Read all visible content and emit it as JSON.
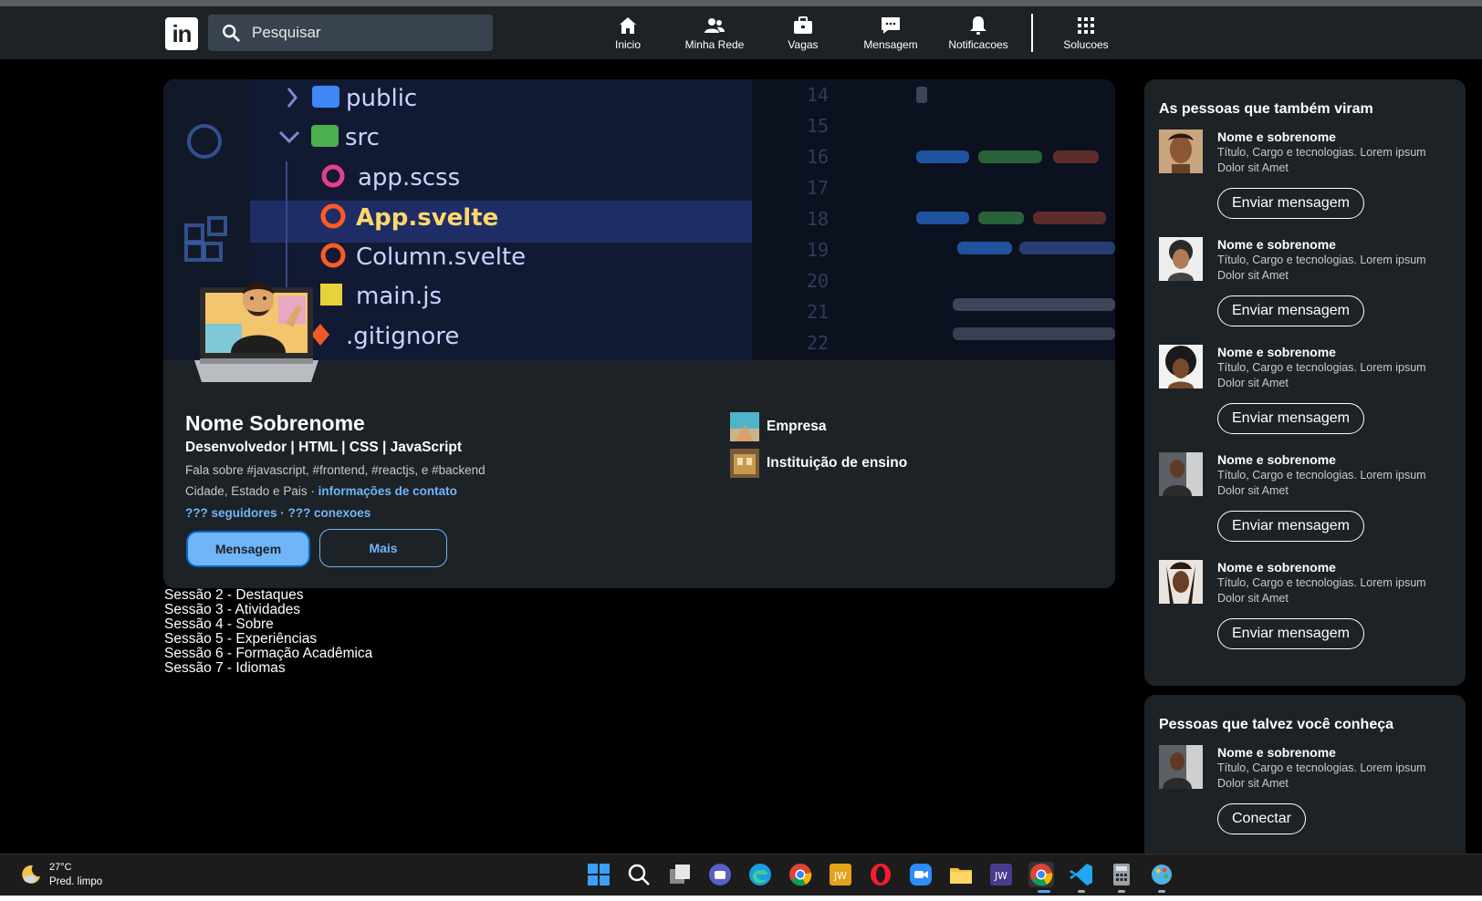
{
  "nav": {
    "logo_text": "in",
    "search_placeholder": "Pesquisar",
    "items": [
      {
        "label": "Inicio",
        "icon": "home-icon"
      },
      {
        "label": "Minha Rede",
        "icon": "network-icon"
      },
      {
        "label": "Vagas",
        "icon": "briefcase-icon"
      },
      {
        "label": "Mensagem",
        "icon": "message-icon"
      },
      {
        "label": "Notificacoes",
        "icon": "bell-icon"
      },
      {
        "label": "Solucoes",
        "icon": "grid-icon"
      }
    ]
  },
  "banner": {
    "files": [
      "public",
      "src",
      "app.scss",
      "App.svelte",
      "Column.svelte",
      "main.js",
      ".gitignore"
    ],
    "line_numbers": [
      "14",
      "15",
      "16",
      "17",
      "18",
      "19",
      "20",
      "21",
      "22"
    ]
  },
  "profile": {
    "name": "Nome Sobrenome",
    "headline": "Desenvolvedor | HTML | CSS | JavaScript",
    "about": "Fala sobre #javascript, #frontend, #reactjs, e #backend",
    "location": "Cidade, Estado e Pais · ",
    "contact_link": "informações de contato",
    "followers": "??? seguidores",
    "separator": " · ",
    "connections": "??? conexoes",
    "message_button": "Mensagem",
    "more_button": "Mais",
    "company": "Empresa",
    "school": "Instituição de ensino"
  },
  "sections": [
    "Sessão 2 - Destaques",
    "Sessão 3 - Atividades",
    "Sessão 4 - Sobre",
    "Sessão 5 - Experiências",
    "Sessão 6 - Formação Acadêmica",
    "Sessão 7 - Idiomas"
  ],
  "also_viewed": {
    "title": "As pessoas que também viram",
    "people": [
      {
        "name": "Nome e sobrenome",
        "desc": "Título, Cargo e tecnologias. Lorem ipsum Dolor sit Amet",
        "button": "Enviar mensagem"
      },
      {
        "name": "Nome e sobrenome",
        "desc": "Título, Cargo e tecnologias. Lorem ipsum Dolor sit Amet",
        "button": "Enviar mensagem"
      },
      {
        "name": "Nome e sobrenome",
        "desc": "Título, Cargo e tecnologias. Lorem ipsum Dolor sit Amet",
        "button": "Enviar mensagem"
      },
      {
        "name": "Nome e sobrenome",
        "desc": "Título, Cargo e tecnologias. Lorem ipsum Dolor sit Amet",
        "button": "Enviar mensagem"
      },
      {
        "name": "Nome e sobrenome",
        "desc": "Título, Cargo e tecnologias. Lorem ipsum Dolor sit Amet",
        "button": "Enviar mensagem"
      }
    ]
  },
  "may_know": {
    "title": "Pessoas que talvez você conheça",
    "people": [
      {
        "name": "Nome e sobrenome",
        "desc": "Título, Cargo e tecnologias. Lorem ipsum Dolor sit Amet",
        "button": "Conectar"
      }
    ]
  },
  "taskbar": {
    "temperature": "27°C",
    "weather": "Pred. limpo"
  },
  "colors": {
    "accent": "#70b5f9",
    "card": "#1d2226",
    "background": "#000000"
  }
}
